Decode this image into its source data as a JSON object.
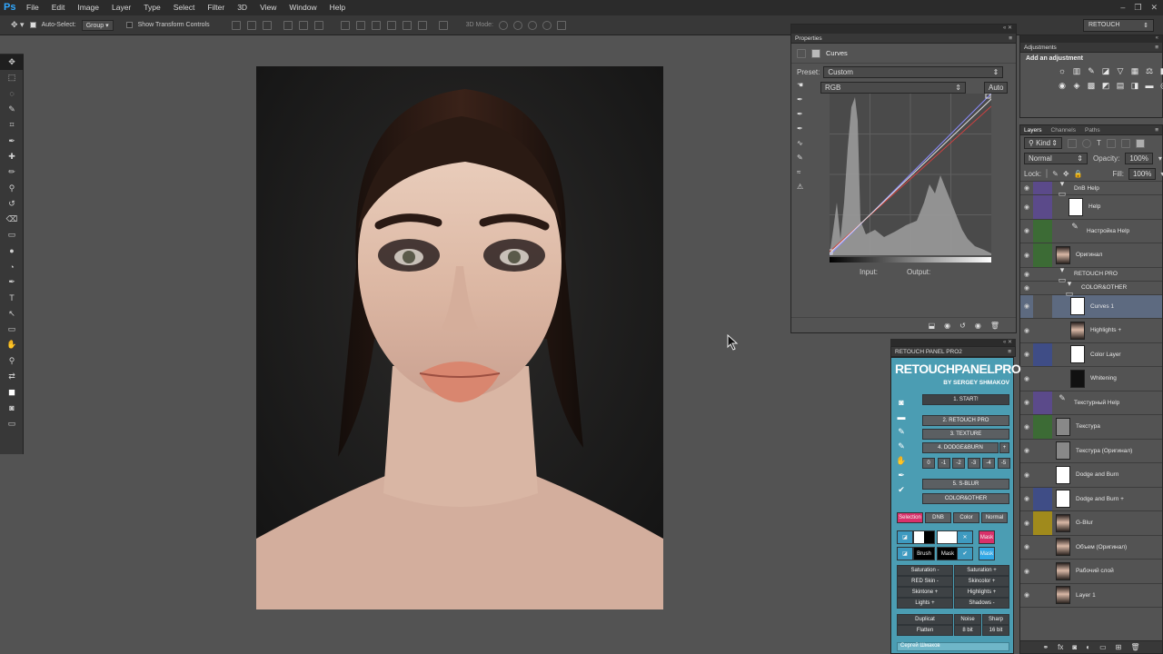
{
  "app": {
    "logo": "Ps"
  },
  "menu": [
    "File",
    "Edit",
    "Image",
    "Layer",
    "Type",
    "Select",
    "Filter",
    "3D",
    "View",
    "Window",
    "Help"
  ],
  "window_controls": [
    "–",
    "❐",
    "✕"
  ],
  "options": {
    "auto_select": "Auto-Select:",
    "group": "Group",
    "show_transform": "Show Transform Controls",
    "mode3d": "3D Mode:"
  },
  "workspace": "RETOUCH",
  "tools": [
    "move-tool",
    "marquee-tool",
    "lasso-tool",
    "quick-select-tool",
    "crop-tool",
    "eyedropper-tool",
    "healing-tool",
    "brush-tool",
    "stamp-tool",
    "history-brush-tool",
    "eraser-tool",
    "gradient-tool",
    "blur-tool",
    "dodge-tool",
    "pen-tool",
    "type-tool",
    "path-select-tool",
    "shape-tool",
    "hand-tool",
    "zoom-tool",
    "swap-colors-tool",
    "foreground-color",
    "quick-mask-tool",
    "screen-mode-tool"
  ],
  "tool_glyphs": [
    "✥",
    "⬚",
    "◌",
    "✎",
    "⌗",
    "✒",
    "✚",
    "✏",
    "⚲",
    "↺",
    "⌫",
    "▭",
    "●",
    "◔",
    "✒",
    "T",
    "↖",
    "▭",
    "✋",
    "⚲",
    "⇄",
    "■",
    "◙",
    "▭"
  ],
  "properties": {
    "title": "Properties",
    "type": "Curves",
    "preset_label": "Preset:",
    "preset_value": "Custom",
    "channel": "RGB",
    "auto": "Auto",
    "input_label": "Input:",
    "output_label": "Output:"
  },
  "adjustments": {
    "title": "Adjustments",
    "subtitle": "Add an adjustment"
  },
  "layers_panel": {
    "tabs": [
      "Layers",
      "Channels",
      "Paths"
    ],
    "kind": "Kind",
    "blend": "Normal",
    "opacity_label": "Opacity:",
    "opacity": "100%",
    "lock_label": "Lock:",
    "fill_label": "Fill:",
    "fill": "100%",
    "layers": [
      {
        "name": "DnB Help",
        "color": "#5b4a8a",
        "thumb": "folder"
      },
      {
        "name": "Help",
        "color": "#5b4a8a",
        "thumb": "white"
      },
      {
        "name": "Настройка Help",
        "color": "#3c6b35",
        "thumb": "curves"
      },
      {
        "name": "Оригинал",
        "color": "#3c6b35",
        "thumb": "photo"
      },
      {
        "name": "RETOUCH PRO",
        "color": "#535353",
        "thumb": "folder"
      },
      {
        "name": "COLOR&OTHER",
        "color": "#535353",
        "thumb": "folder"
      },
      {
        "name": "Curves 1",
        "color": "#535353",
        "thumb": "white",
        "selected": true
      },
      {
        "name": "Highlights +",
        "color": "#535353",
        "thumb": "photo"
      },
      {
        "name": "Color Layer",
        "color": "#3f4d86",
        "thumb": "white"
      },
      {
        "name": "Whitening",
        "color": "#535353",
        "thumb": "dark"
      },
      {
        "name": "Текстурный Help",
        "color": "#5b4a8a",
        "thumb": "curves"
      },
      {
        "name": "Текстура",
        "color": "#3c6b35",
        "thumb": "grey"
      },
      {
        "name": "Текстура (Оригинал)",
        "color": "#535353",
        "thumb": "grey"
      },
      {
        "name": "Dodge and Burn",
        "color": "#535353",
        "thumb": "white"
      },
      {
        "name": "Dodge and Burn +",
        "color": "#3f4d86",
        "thumb": "white"
      },
      {
        "name": "G-Blur",
        "color": "#a08a1c",
        "thumb": "photo"
      },
      {
        "name": "Объем (Оригинал)",
        "color": "#535353",
        "thumb": "photo"
      },
      {
        "name": "Рабочий слой",
        "color": "#535353",
        "thumb": "photo"
      },
      {
        "name": "Layer 1",
        "color": "#535353",
        "thumb": "photo"
      }
    ]
  },
  "retouch_panel": {
    "title": "RETOUCH PANEL PRO2",
    "brand": "RETOUCHPANELPRO",
    "author": "BY SERGEY SHMAKOV",
    "buttons": [
      "1. START!",
      "2. RETOUCH PRO",
      "3. TEXTURE",
      "4. DODGE&BURN",
      "5. S-BLUR",
      "COLOR&OTHER"
    ],
    "plus": "+",
    "dnb_levels": [
      "0",
      "-1",
      "-2",
      "-3",
      "-4",
      "-5"
    ],
    "mode_row": [
      "Selection",
      "DNB",
      "Color",
      "Normal"
    ],
    "mask_labels": [
      "Mask",
      "Brush",
      "Mask",
      "Mask"
    ],
    "adjust_left": [
      "Saturation -",
      "RED Skin -",
      "Skintone +",
      "Lights +"
    ],
    "adjust_right": [
      "Saturation +",
      "Skincolor +",
      "Highlights +",
      "Shadows -"
    ],
    "bottom_left": [
      "Duplicat",
      "Flatten"
    ],
    "bottom_mid": [
      "Noise",
      "8 bit"
    ],
    "bottom_right": [
      "Sharp",
      "16 bit"
    ],
    "footer": "Сергей Шмаков"
  }
}
